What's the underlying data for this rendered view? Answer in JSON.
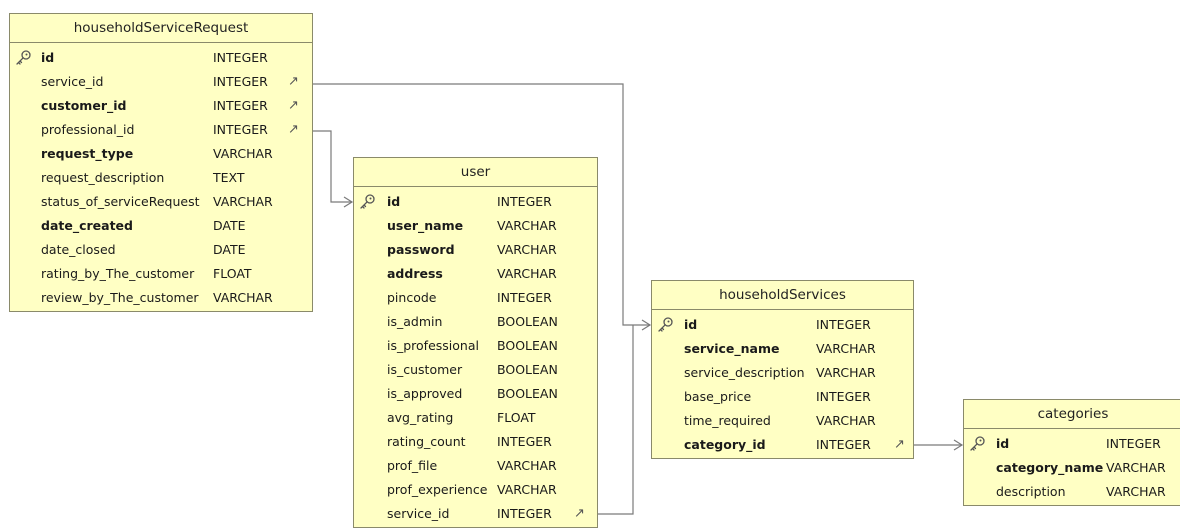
{
  "tables": [
    {
      "key": "household_service_request",
      "title": "householdServiceRequest",
      "columns": [
        {
          "name": "id",
          "type": "INTEGER",
          "pk": true,
          "bold": true,
          "fk": false
        },
        {
          "name": "service_id",
          "type": "INTEGER",
          "pk": false,
          "bold": false,
          "fk": true
        },
        {
          "name": "customer_id",
          "type": "INTEGER",
          "pk": false,
          "bold": true,
          "fk": true
        },
        {
          "name": "professional_id",
          "type": "INTEGER",
          "pk": false,
          "bold": false,
          "fk": true
        },
        {
          "name": "request_type",
          "type": "VARCHAR",
          "pk": false,
          "bold": true,
          "fk": false
        },
        {
          "name": "request_description",
          "type": "TEXT",
          "pk": false,
          "bold": false,
          "fk": false
        },
        {
          "name": "status_of_serviceRequest",
          "type": "VARCHAR",
          "pk": false,
          "bold": false,
          "fk": false
        },
        {
          "name": "date_created",
          "type": "DATE",
          "pk": false,
          "bold": true,
          "fk": false
        },
        {
          "name": "date_closed",
          "type": "DATE",
          "pk": false,
          "bold": false,
          "fk": false
        },
        {
          "name": "rating_by_The_customer",
          "type": "FLOAT",
          "pk": false,
          "bold": false,
          "fk": false
        },
        {
          "name": "review_by_The_customer",
          "type": "VARCHAR",
          "pk": false,
          "bold": false,
          "fk": false
        }
      ]
    },
    {
      "key": "user",
      "title": "user",
      "columns": [
        {
          "name": "id",
          "type": "INTEGER",
          "pk": true,
          "bold": true,
          "fk": false
        },
        {
          "name": "user_name",
          "type": "VARCHAR",
          "pk": false,
          "bold": true,
          "fk": false
        },
        {
          "name": "password",
          "type": "VARCHAR",
          "pk": false,
          "bold": true,
          "fk": false
        },
        {
          "name": "address",
          "type": "VARCHAR",
          "pk": false,
          "bold": true,
          "fk": false
        },
        {
          "name": "pincode",
          "type": "INTEGER",
          "pk": false,
          "bold": false,
          "fk": false
        },
        {
          "name": "is_admin",
          "type": "BOOLEAN",
          "pk": false,
          "bold": false,
          "fk": false
        },
        {
          "name": "is_professional",
          "type": "BOOLEAN",
          "pk": false,
          "bold": false,
          "fk": false
        },
        {
          "name": "is_customer",
          "type": "BOOLEAN",
          "pk": false,
          "bold": false,
          "fk": false
        },
        {
          "name": "is_approved",
          "type": "BOOLEAN",
          "pk": false,
          "bold": false,
          "fk": false
        },
        {
          "name": "avg_rating",
          "type": "FLOAT",
          "pk": false,
          "bold": false,
          "fk": false
        },
        {
          "name": "rating_count",
          "type": "INTEGER",
          "pk": false,
          "bold": false,
          "fk": false
        },
        {
          "name": "prof_file",
          "type": "VARCHAR",
          "pk": false,
          "bold": false,
          "fk": false
        },
        {
          "name": "prof_experience",
          "type": "VARCHAR",
          "pk": false,
          "bold": false,
          "fk": false
        },
        {
          "name": "service_id",
          "type": "INTEGER",
          "pk": false,
          "bold": false,
          "fk": true
        }
      ]
    },
    {
      "key": "household_services",
      "title": "householdServices",
      "columns": [
        {
          "name": "id",
          "type": "INTEGER",
          "pk": true,
          "bold": true,
          "fk": false
        },
        {
          "name": "service_name",
          "type": "VARCHAR",
          "pk": false,
          "bold": true,
          "fk": false
        },
        {
          "name": "service_description",
          "type": "VARCHAR",
          "pk": false,
          "bold": false,
          "fk": false
        },
        {
          "name": "base_price",
          "type": "INTEGER",
          "pk": false,
          "bold": false,
          "fk": false
        },
        {
          "name": "time_required",
          "type": "VARCHAR",
          "pk": false,
          "bold": false,
          "fk": false
        },
        {
          "name": "category_id",
          "type": "INTEGER",
          "pk": false,
          "bold": true,
          "fk": true
        }
      ]
    },
    {
      "key": "categories",
      "title": "categories",
      "columns": [
        {
          "name": "id",
          "type": "INTEGER",
          "pk": true,
          "bold": true,
          "fk": false
        },
        {
          "name": "category_name",
          "type": "VARCHAR",
          "pk": false,
          "bold": true,
          "fk": false
        },
        {
          "name": "description",
          "type": "VARCHAR",
          "pk": false,
          "bold": false,
          "fk": false
        }
      ]
    }
  ],
  "icons": {
    "primary_key": "key-icon",
    "foreign_key": "fk-arrow-icon"
  },
  "colors": {
    "table_fill": "#ffffc4",
    "table_border": "#8a8a6a",
    "connector": "#7a7a7a"
  }
}
